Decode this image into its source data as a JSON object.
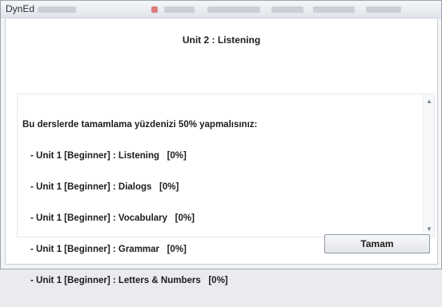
{
  "window": {
    "title": "DynEd"
  },
  "dialog": {
    "header": "Unit 2 : Listening",
    "message": {
      "intro": "Bu derslerde tamamlama yüzdenizi 50% yapmalısınız:",
      "items": [
        "- Unit 1 [Beginner] : Listening   [0%]",
        "- Unit 1 [Beginner] : Dialogs   [0%]",
        "- Unit 1 [Beginner] : Vocabulary   [0%]",
        "- Unit 1 [Beginner] : Grammar   [0%]",
        "- Unit 1 [Beginner] : Letters & Numbers   [0%]"
      ]
    },
    "ok_label": "Tamam"
  },
  "icons": {
    "scroll_up": "scroll-up-arrow",
    "scroll_down": "scroll-down-arrow"
  },
  "colors": {
    "dialog_background": "#ffffff",
    "button_border": "#8f99a4",
    "text": "#1c1c1c"
  }
}
